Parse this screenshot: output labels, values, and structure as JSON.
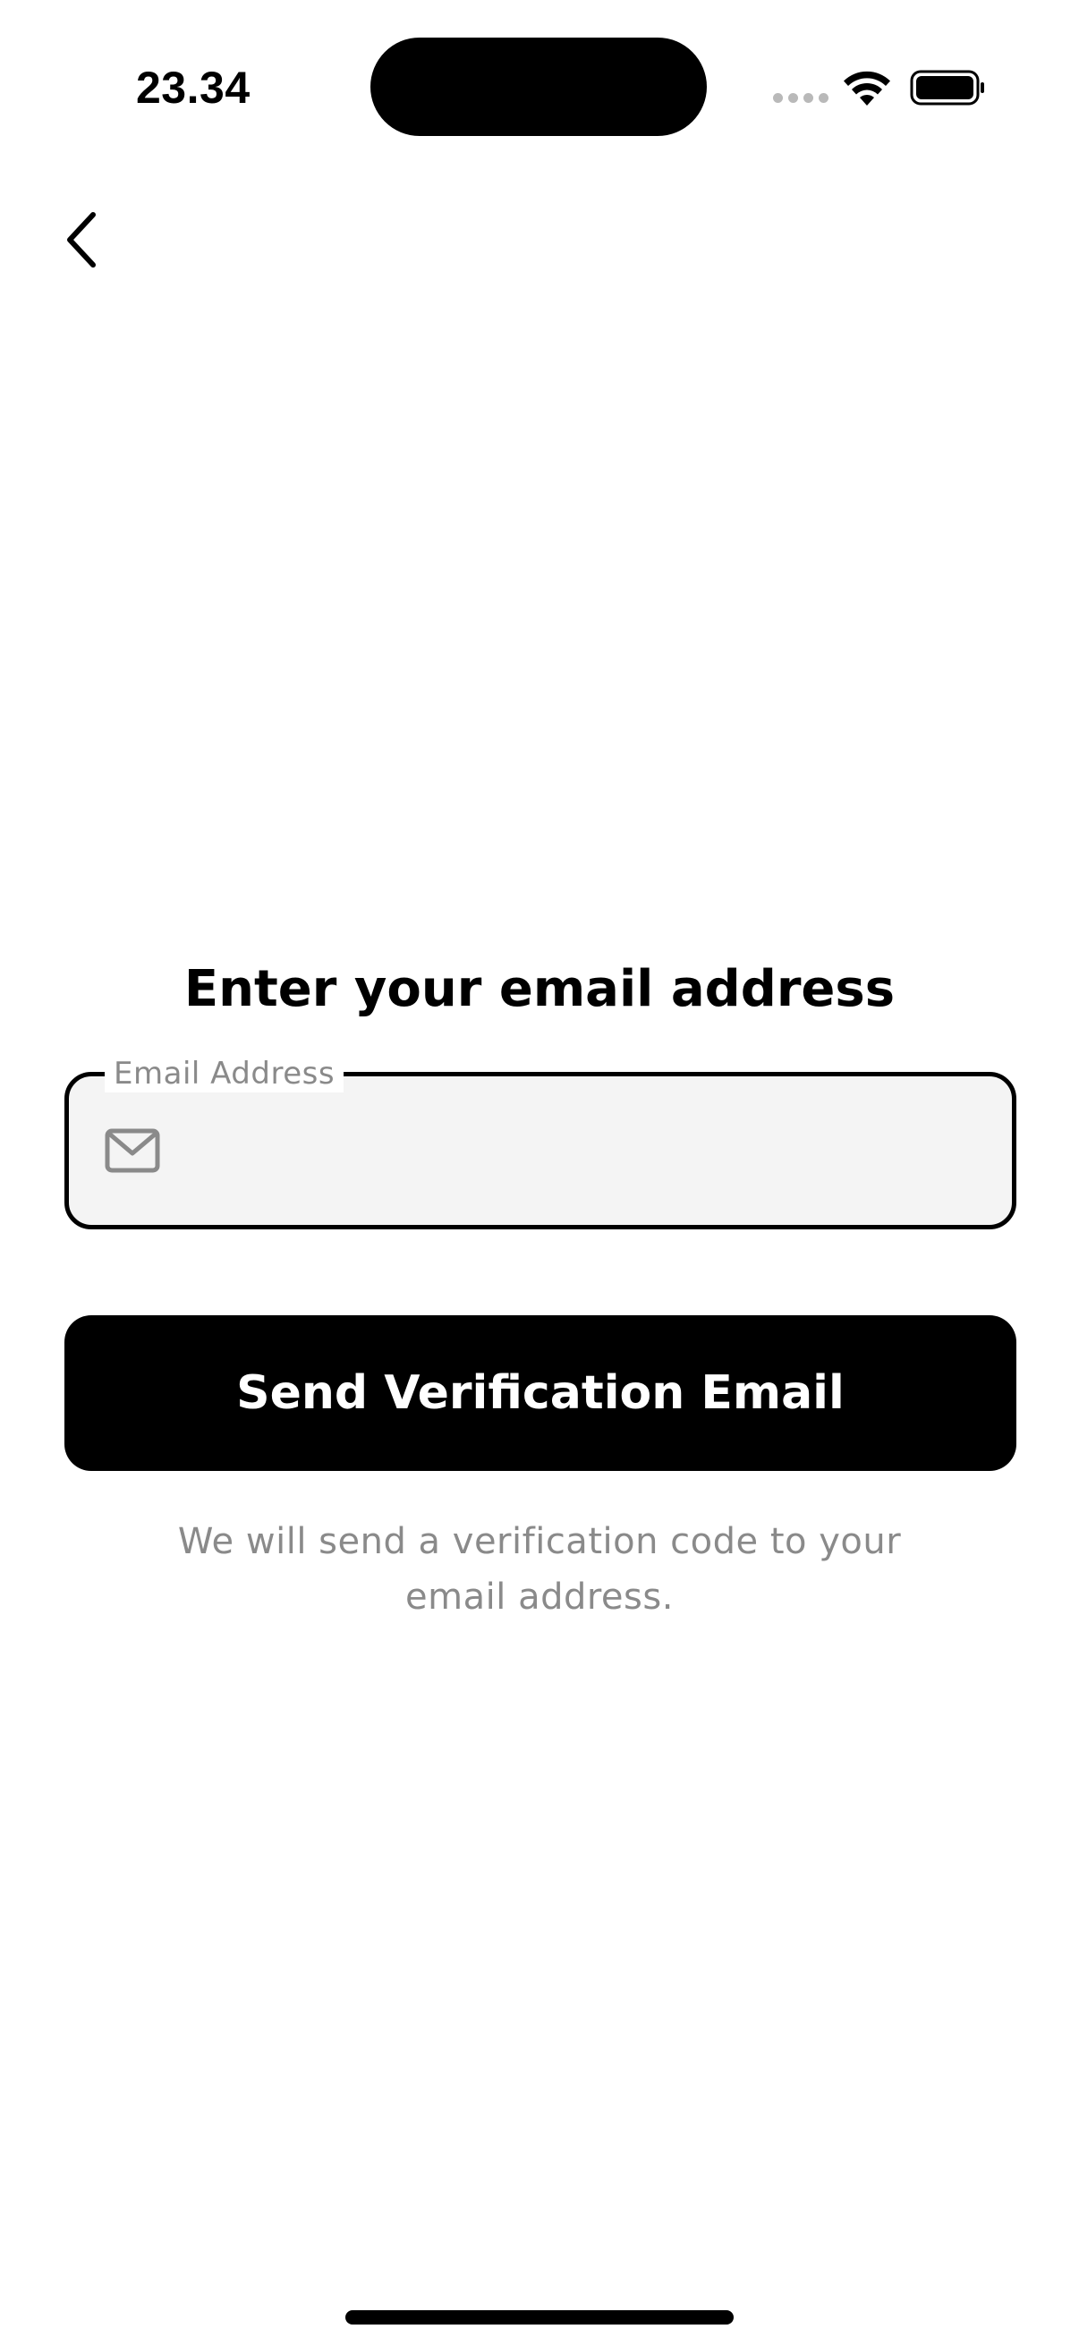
{
  "status_bar": {
    "time": "23.34",
    "wifi_icon": "wifi-icon",
    "battery_icon": "battery-icon"
  },
  "nav": {
    "back_icon": "chevron-left-icon"
  },
  "screen": {
    "title": "Enter your email address"
  },
  "email_field": {
    "label": "Email Address",
    "value": "",
    "placeholder": "",
    "icon": "mail-icon"
  },
  "send_button": {
    "label": "Send Verification Email"
  },
  "helper_text": "We will send a verification code to your email address.",
  "colors": {
    "primary": "#000000",
    "background": "#ffffff",
    "field_background": "#f4f4f4",
    "muted_text": "#8a8a8a"
  }
}
